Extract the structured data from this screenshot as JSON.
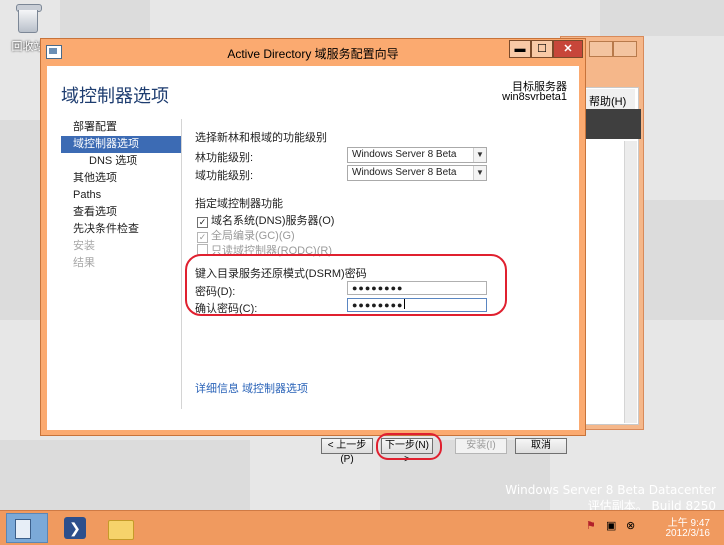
{
  "desktop": {
    "recycle_bin_label": "回收站",
    "watermark_line1": "Windows Server 8 Beta Datacenter",
    "watermark_line2": "评估副本。 Build 8250"
  },
  "background_window": {
    "menu_help": "帮助(H)"
  },
  "window": {
    "title": "Active Directory 域服务配置向导",
    "controls": {
      "minimize": "▬",
      "maximize": "☐",
      "close": "✕"
    }
  },
  "header": {
    "page_title": "域控制器选项",
    "target_server_label": "目标服务器",
    "target_server_name": "win8svrbeta1"
  },
  "nav": {
    "items": [
      {
        "label": "部署配置",
        "state": "normal"
      },
      {
        "label": "域控制器选项",
        "state": "active"
      },
      {
        "label": "DNS 选项",
        "state": "sub"
      },
      {
        "label": "其他选项",
        "state": "normal"
      },
      {
        "label": "Paths",
        "state": "normal"
      },
      {
        "label": "查看选项",
        "state": "normal"
      },
      {
        "label": "先决条件检查",
        "state": "normal"
      },
      {
        "label": "安装",
        "state": "disabled"
      },
      {
        "label": "结果",
        "state": "disabled"
      }
    ]
  },
  "form": {
    "functional_level_heading": "选择新林和根域的功能级别",
    "forest_level_label": "林功能级别:",
    "forest_level_value": "Windows Server 8 Beta",
    "domain_level_label": "域功能级别:",
    "domain_level_value": "Windows Server 8 Beta",
    "dc_capabilities_heading": "指定域控制器功能",
    "dns_checkbox": "域名系统(DNS)服务器(O)",
    "gc_checkbox": "全局编录(GC)(G)",
    "rodc_checkbox": "只读域控制器(RODC)(R)",
    "dsrm_heading": "键入目录服务还原模式(DSRM)密码",
    "password_label": "密码(D):",
    "password_value": "●●●●●●●●",
    "confirm_label": "确认密码(C):",
    "confirm_value": "●●●●●●●●",
    "more_info_link": "详细信息 域控制器选项"
  },
  "buttons": {
    "previous": "< 上一步(P)",
    "next": "下一步(N) >",
    "install": "安装(I)",
    "cancel": "取消"
  },
  "taskbar": {
    "powershell_icon": "❯",
    "tray_icons": [
      "⚑",
      "▣",
      "⊗"
    ],
    "time": "上午 9:47",
    "date": "2012/3/16"
  },
  "colors": {
    "accent_orange": "#fbaa70",
    "nav_active": "#3c6bb4",
    "highlight_red": "#e0202f",
    "title_blue": "#1e3d70"
  }
}
